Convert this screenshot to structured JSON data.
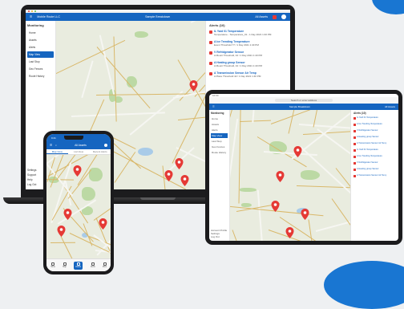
{
  "colors": {
    "brand": "#1565c0",
    "pin": "#e53935",
    "accent": "#1976d2"
  },
  "laptop": {
    "app_name": "Mobile Route LLC",
    "header_center": "Sample Breakdown",
    "header_right": "All Assets",
    "sidebar_title": "Monitoring",
    "sidebar_items": [
      "Home",
      "Assets",
      "Alerts",
      "Map View",
      "Last Stop",
      "Geo Fences",
      "Route History"
    ],
    "sidebar_footer": [
      "Settings",
      "Support",
      "Help",
      "Log Out"
    ],
    "panel_title": "Alerts (10)",
    "alerts": [
      {
        "title": "IL Yard 01 Temperature",
        "sub": "Temperature - Temperature_01 - 1 Day 2021 1:40 PM"
      },
      {
        "title": "A Ice Trending Temperature",
        "sub": "Event Threshold 77 / 1 Day 2021 1:40 PM"
      },
      {
        "title": "V Refridgerator Sensor",
        "sub": "A Mount Threshold, 42 / 1 Day 2021 1:40 PM"
      },
      {
        "title": "A Heating group Sensor",
        "sub": "A Mount Threshold, 42 / 1 Day 2021 1:40 PM"
      },
      {
        "title": "A Transmission Sensor Air Temp",
        "sub": "A Place Threshold 42 / 1 Day 2021 1:40 PM"
      }
    ]
  },
  "tablet": {
    "time": "10:34",
    "search": "Search or enter address",
    "header_center": "Sample Breakdown",
    "header_right": "All Assets",
    "sidebar_title": "Monitoring",
    "sidebar_items": [
      "Home",
      "Assets",
      "Alerts",
      "Map View",
      "Last Stop",
      "Geo Fences",
      "Route History"
    ],
    "sidebar_footer": [
      "Account Profile",
      "Settings",
      "Log Out"
    ],
    "panel_title": "Alerts (10)",
    "alerts": [
      "IL Yard 01 Temperature",
      "A Ice Trending Temperature",
      "V Refridgerator Sensor",
      "A Heating group Sensor",
      "A Transmission Sensor Air Temp",
      "IL Yard 01 Temperature",
      "A Ice Trending Temperature",
      "V Refridgerator Sensor",
      "A Heating group Sensor",
      "A Transmission Sensor Air Temp"
    ]
  },
  "phone": {
    "time": "9:41",
    "header_title": "All Assets",
    "tabs": [
      "Map View",
      "List View",
      "Recent Alerts"
    ],
    "nav": [
      "Home",
      "Map",
      "Assets",
      "Alerts",
      "More"
    ]
  }
}
